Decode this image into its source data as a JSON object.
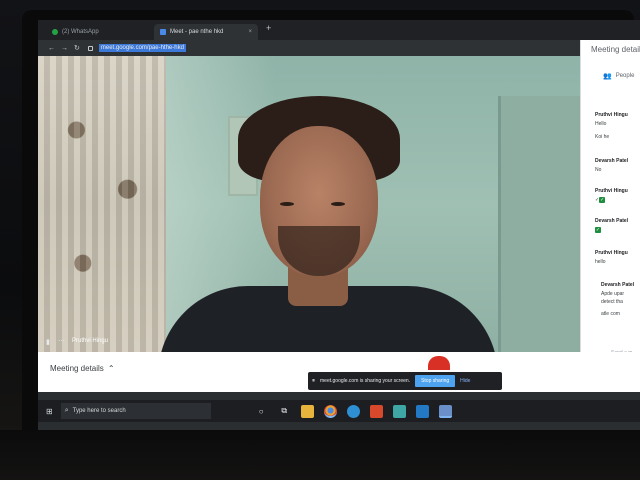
{
  "browser": {
    "tabs": [
      {
        "label": "(2) WhatsApp"
      },
      {
        "label": "Meet - pae nthe hkd"
      }
    ],
    "url": "meet.google.com/pae-hthe-hkd"
  },
  "video": {
    "participant_name": "Pruthvi Hingu"
  },
  "side_panel": {
    "title": "Meeting details",
    "people_label": "People",
    "messages": [
      {
        "sender": "Pruthvi Hingu",
        "lines": [
          "Hello",
          "Koi he"
        ]
      },
      {
        "sender": "Devarsh Patel",
        "lines": [
          "No"
        ]
      },
      {
        "sender": "Pruthvi Hingu",
        "lines": [
          "✓"
        ]
      },
      {
        "sender": "Devarsh Patel",
        "lines": [
          ""
        ]
      },
      {
        "sender": "Pruthvi Hingu",
        "lines": [
          "hello"
        ]
      },
      {
        "sender": "Devarsh Patel",
        "lines": [
          "Apde upar",
          "detect tha",
          "atle com"
        ]
      }
    ],
    "send_placeholder": "Send a m"
  },
  "meeting_bar": {
    "details_label": "Meeting details",
    "share_text": "meet.google.com is sharing your screen.",
    "stop_label": "Stop sharing",
    "hide_label": "Hide"
  },
  "taskbar": {
    "search_placeholder": "Type here to search"
  }
}
